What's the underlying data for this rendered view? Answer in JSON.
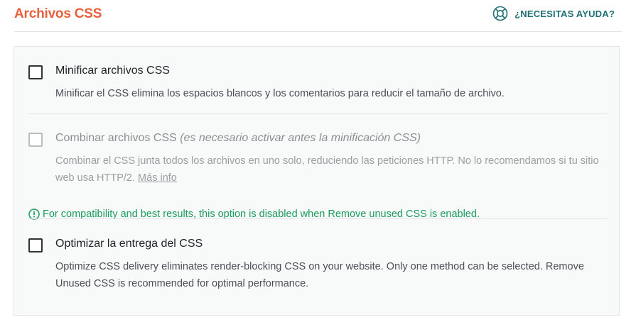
{
  "header": {
    "title": "Archivos CSS",
    "help_label": "¿NECESITAS AYUDA?",
    "help_icon": "lifebuoy-icon"
  },
  "options": [
    {
      "title": "Minificar archivos CSS",
      "description": "Minificar el CSS elimina los espacios blancos y los comentarios para reducir el tamaño de archivo.",
      "checked": false,
      "disabled": false
    },
    {
      "title": "Combinar archivos CSS",
      "title_note": "(es necesario activar antes la minificación CSS)",
      "description": "Combinar el CSS junta todos los archivos en uno solo, reduciendo las peticiones HTTP. No lo recomendamos si tu sitio web usa HTTP/2.",
      "link_label": "Más info",
      "notice": "For compatibility and best results, this option is disabled when Remove unused CSS is enabled.",
      "notice_icon": "exclamation-circle-icon",
      "checked": false,
      "disabled": true
    },
    {
      "title": "Optimizar la entrega del CSS",
      "description": "Optimize CSS delivery eliminates render-blocking CSS on your website. Only one method can be selected. Remove Unused CSS is recommended for optimal performance.",
      "checked": false,
      "disabled": false
    }
  ],
  "colors": {
    "title_accent": "#e8613c",
    "help_link": "#1f6f74",
    "notice_green": "#1a9c5c"
  }
}
